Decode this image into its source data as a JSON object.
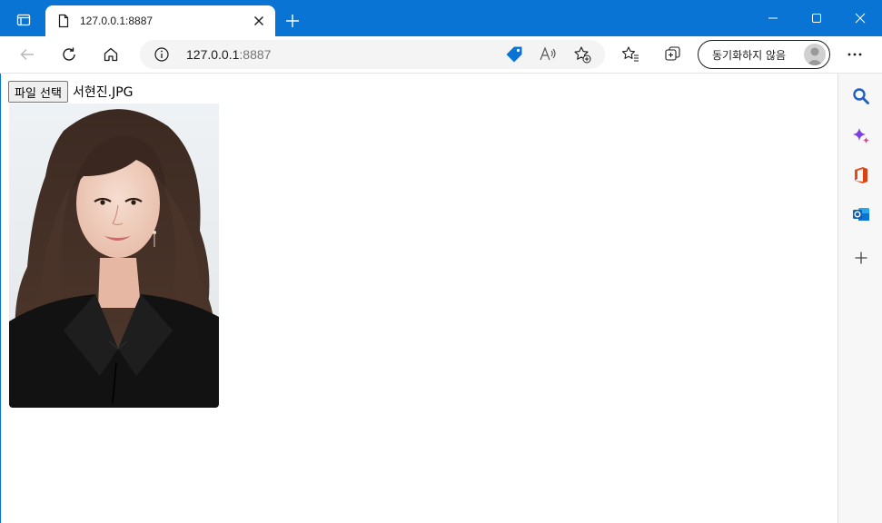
{
  "browser": {
    "tab": {
      "title": "127.0.0.1:8887"
    },
    "address_bar": {
      "host": "127.0.0.1",
      "port": ":8887"
    },
    "profile": {
      "label": "동기화하지 않음"
    }
  },
  "page": {
    "file_input": {
      "button_label": "파일 선택",
      "file_name": "서현진.JPG"
    }
  },
  "colors": {
    "titlebar": "#0a74d4",
    "accent": "#0a74d4"
  },
  "icons": [
    "tab-actions-icon",
    "page-icon",
    "close-icon",
    "plus-icon",
    "minimize-icon",
    "maximize-icon",
    "window-close-icon",
    "back-icon",
    "refresh-icon",
    "home-icon",
    "info-icon",
    "shopping-tag-icon",
    "read-aloud-icon",
    "add-favorite-icon",
    "favorites-icon",
    "collections-icon",
    "more-icon",
    "search-icon",
    "sparkle-icon",
    "office-icon",
    "outlook-icon",
    "add-icon"
  ]
}
